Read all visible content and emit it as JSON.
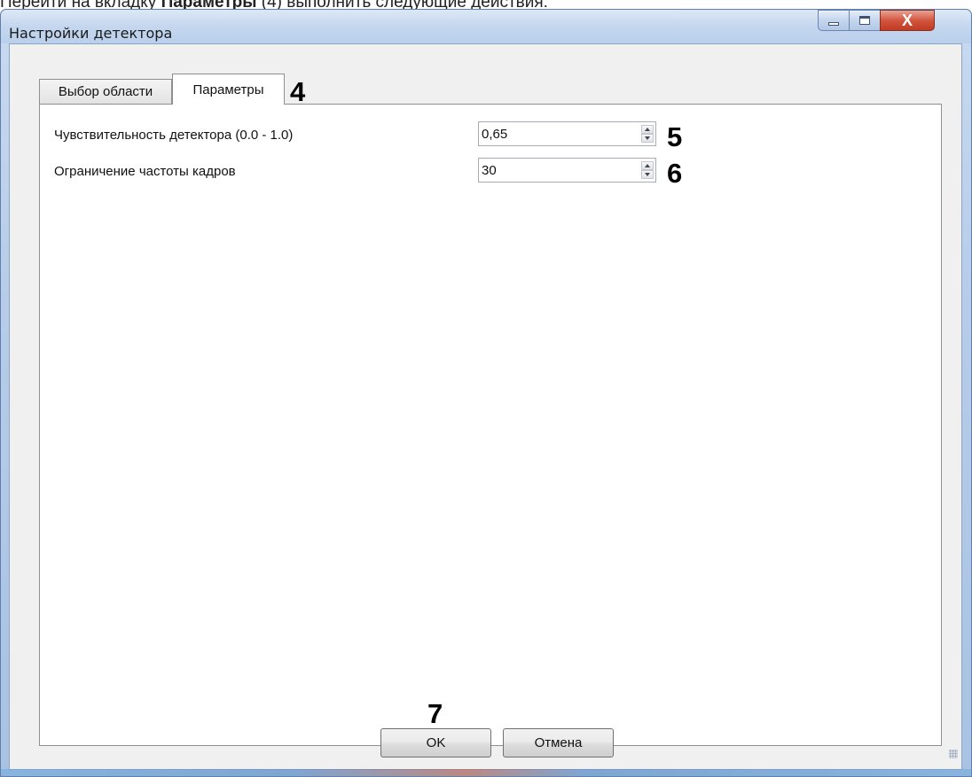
{
  "doc_line": {
    "before": "Перейти на вкладку ",
    "bold": "Параметры",
    "after": " (4) выполнить следующие действия:"
  },
  "window": {
    "title": "Настройки детектора",
    "controls": {
      "minimize_icon": "minimize-icon",
      "maximize_icon": "maximize-icon",
      "close_glyph": "X"
    }
  },
  "tabs": [
    {
      "label": "Выбор области",
      "active": false
    },
    {
      "label": "Параметры",
      "active": true
    }
  ],
  "fields": {
    "sensitivity": {
      "label": "Чувствительность детектора (0.0 - 1.0)",
      "value": "0,65"
    },
    "frame_limit": {
      "label": "Ограничение частоты кадров",
      "value": "30"
    }
  },
  "callouts": {
    "tab": "4",
    "sensitivity": "5",
    "frame_limit": "6",
    "ok": "7"
  },
  "buttons": {
    "ok": "OK",
    "cancel": "Отмена"
  },
  "colors": {
    "close_button": "#c23a22",
    "frame": "#b7cde9",
    "panel": "#ffffff"
  }
}
